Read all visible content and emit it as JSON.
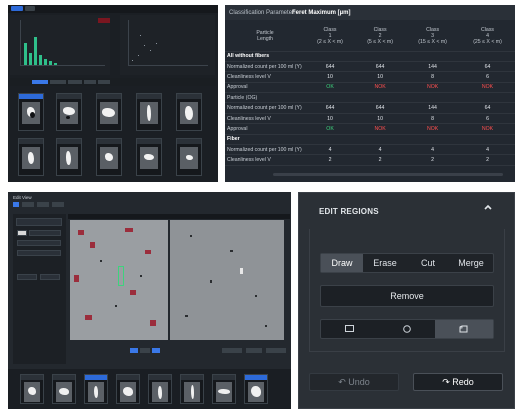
{
  "table_panel": {
    "param_label": "Classification Parameter:",
    "param_value": "Feret Maximum [µm]",
    "header_left": [
      "Particle",
      "Length"
    ],
    "classes": [
      {
        "name": "Class",
        "num": "1",
        "range": "(2 ≤ X < m)"
      },
      {
        "name": "Class",
        "num": "2",
        "range": "(5 ≤ X < m)"
      },
      {
        "name": "Class",
        "num": "3",
        "range": "(15 ≤ X < m)"
      },
      {
        "name": "Class",
        "num": "4",
        "range": "(25 ≤ X < m)"
      }
    ],
    "rows": [
      {
        "label": "All without fibers",
        "type": "section",
        "values": [
          "",
          "",
          "",
          ""
        ]
      },
      {
        "label": "Normalized count per 100 ml (Y)",
        "type": "data",
        "values": [
          "644",
          "644",
          "144",
          "64"
        ]
      },
      {
        "label": "Cleanliness level V",
        "type": "data",
        "values": [
          "10",
          "10",
          "8",
          "6"
        ]
      },
      {
        "label": "Approval",
        "type": "status",
        "values": [
          "OK",
          "NOK",
          "NOK",
          "NOK"
        ]
      },
      {
        "label": "Particle (OG)",
        "type": "subsection",
        "values": [
          "",
          "",
          "",
          ""
        ]
      },
      {
        "label": "Normalized count per 100 ml (Y)",
        "type": "data",
        "values": [
          "644",
          "644",
          "144",
          "64"
        ]
      },
      {
        "label": "Cleanliness level V",
        "type": "data",
        "values": [
          "10",
          "10",
          "8",
          "6"
        ]
      },
      {
        "label": "Approval",
        "type": "status",
        "values": [
          "OK",
          "NOK",
          "NOK",
          "NOK"
        ]
      },
      {
        "label": "Fiber",
        "type": "section",
        "values": [
          "",
          "",
          "",
          ""
        ]
      },
      {
        "label": "Normalized count per 100 ml (Y)",
        "type": "data",
        "values": [
          "4",
          "4",
          "4",
          "4"
        ]
      },
      {
        "label": "Cleanliness level V",
        "type": "data",
        "values": [
          "2",
          "2",
          "2",
          "2"
        ]
      }
    ],
    "colors": {
      "ok": "#3ed27d",
      "nok": "#ff4f4f"
    }
  },
  "edit_view": {
    "title": "Edit View"
  },
  "edit_regions": {
    "title": "EDIT REGIONS",
    "modes": [
      "Draw",
      "Erase",
      "Cut",
      "Merge"
    ],
    "active_mode": "Draw",
    "remove_label": "Remove",
    "shape_icons": [
      "rectangle-icon",
      "circle-icon",
      "polygon-icon"
    ],
    "active_shape": "polygon-icon",
    "undo_label": "Undo",
    "redo_label": "Redo",
    "undo_icon": "↶",
    "redo_icon": "↷"
  }
}
